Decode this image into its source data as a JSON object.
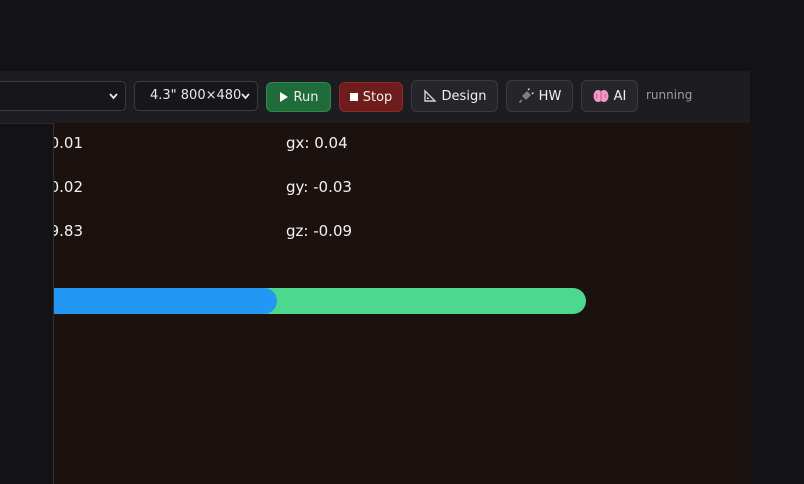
{
  "toolbar": {
    "device_select_value": "",
    "screen_select_value": "4.3\" 800×480",
    "run_label": "Run",
    "stop_label": "Stop",
    "design_label": "Design",
    "hw_label": "HW",
    "ai_label": "AI",
    "status": "running"
  },
  "icons": {
    "run": "play-icon",
    "stop": "stop-icon",
    "design": "set-square-icon",
    "hw": "plug-icon",
    "ai": "brain-icon",
    "select": "chevron-down-icon"
  },
  "readouts": {
    "ax": "0.01",
    "ay": "0.02",
    "az": "9.83",
    "gx": "gx: 0.04",
    "gy": "gy: -0.03",
    "gz": "gz: -0.09"
  },
  "progress": {
    "value_fraction": 0.45
  },
  "colors": {
    "run": "#1f6b3a",
    "stop": "#6e1c1c",
    "bar_fill": "#2397f4",
    "bar_track": "#4cd88e",
    "canvas": "#1b1210"
  }
}
